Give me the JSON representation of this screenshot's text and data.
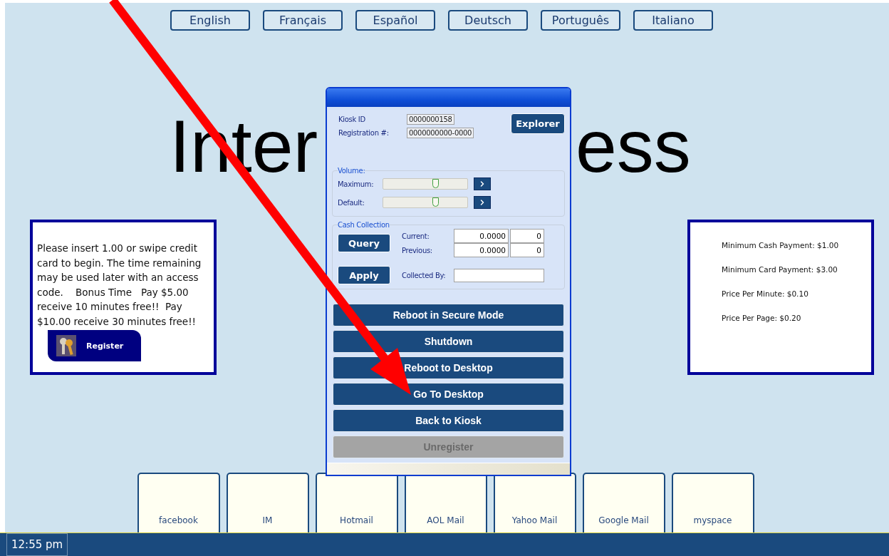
{
  "languages": [
    {
      "label": "English"
    },
    {
      "label": "Français"
    },
    {
      "label": "Español"
    },
    {
      "label": "Deutsch"
    },
    {
      "label": "Português"
    },
    {
      "label": "Italiano"
    }
  ],
  "heading_parts": [
    "Inter",
    "ess"
  ],
  "info_card": {
    "text": "Please insert 1.00 or swipe credit card to begin. The time remaining may be used later with an access code.    Bonus Time   Pay $5.00 receive 10 minutes free!!  Pay $10.00 receive 30 minutes free!!",
    "register": "Register"
  },
  "prices": [
    "Minimum Cash Payment: $1.00",
    "Minimum Card Payment: $3.00",
    "Price Per Minute: $0.10",
    "Price Per Page: $0.20"
  ],
  "dialog": {
    "kiosk_id_label": "Kiosk ID",
    "kiosk_id": "0000000158",
    "registration_label": "Registration #:",
    "registration": "0000000000-0000",
    "explorer": "Explorer",
    "volume": {
      "legend": "Volume:",
      "sliders": [
        {
          "label": "Maximum:",
          "level": 0.62
        },
        {
          "label": "Default:",
          "level": 0.62
        }
      ]
    },
    "cash": {
      "legend": "Cash Collection",
      "query": "Query",
      "apply": "Apply",
      "current_label": "Current:",
      "current_amount": "0.0000",
      "current_count": "0",
      "previous_label": "Previous:",
      "previous_amount": "0.0000",
      "previous_count": "0",
      "collected_by_label": "Collected By:"
    },
    "actions": [
      {
        "label": "Reboot in Secure Mode",
        "disabled": false
      },
      {
        "label": "Shutdown",
        "disabled": false
      },
      {
        "label": "Reboot to Desktop",
        "disabled": false
      },
      {
        "label": "Go To Desktop",
        "disabled": false
      },
      {
        "label": "Back to Kiosk",
        "disabled": false
      },
      {
        "label": "Unregister",
        "disabled": true
      }
    ]
  },
  "tiles": [
    {
      "label": "facebook"
    },
    {
      "label": "IM"
    },
    {
      "label": "Hotmail"
    },
    {
      "label": "AOL Mail"
    },
    {
      "label": "Yahoo Mail"
    },
    {
      "label": "Google Mail"
    },
    {
      "label": "myspace"
    }
  ],
  "taskbar": {
    "clock": "12:55 pm"
  }
}
